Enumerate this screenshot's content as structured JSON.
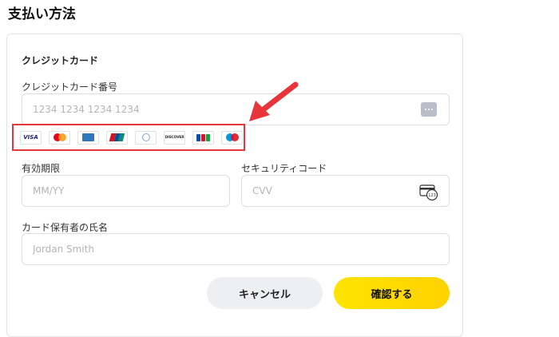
{
  "page": {
    "title": "支払い方法"
  },
  "form": {
    "section_title": "クレジットカード",
    "card_number": {
      "label": "クレジットカード番号",
      "placeholder": "1234 1234 1234 1234"
    },
    "expiry": {
      "label": "有効期限",
      "placeholder": "MM/YY"
    },
    "cvv": {
      "label": "セキュリティコード",
      "placeholder": "CVV",
      "icon_text": "123"
    },
    "holder": {
      "label": "カード保有者の氏名",
      "placeholder": "Jordan Smith"
    },
    "brands": [
      {
        "name": "visa",
        "text": "VISA"
      },
      {
        "name": "mastercard"
      },
      {
        "name": "amex"
      },
      {
        "name": "unionpay"
      },
      {
        "name": "diners"
      },
      {
        "name": "discover",
        "text": "DISCOVER"
      },
      {
        "name": "jcb"
      },
      {
        "name": "maestro"
      }
    ]
  },
  "buttons": {
    "cancel": "キャンセル",
    "confirm": "確認する"
  },
  "colors": {
    "highlight": "#e8343b",
    "confirm_yellow": "#ffd600",
    "cancel_gray": "#eeeff3"
  }
}
